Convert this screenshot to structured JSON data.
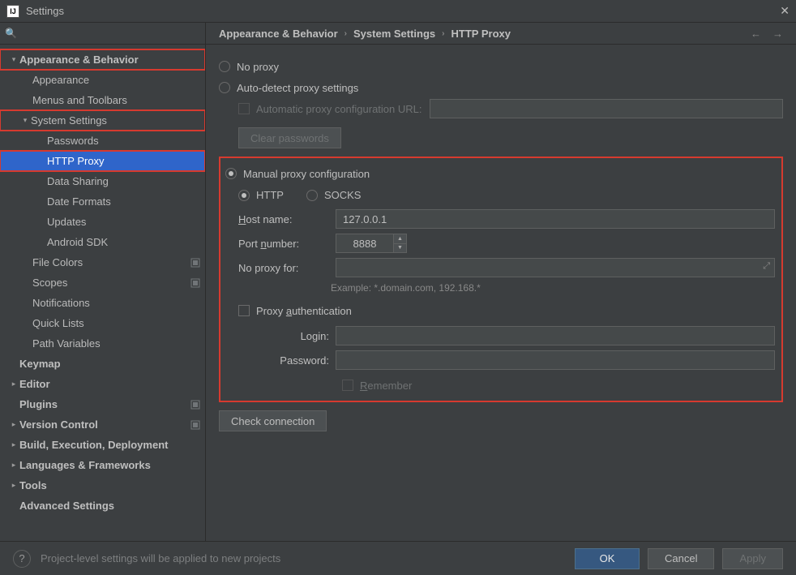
{
  "window": {
    "title": "Settings"
  },
  "search": {
    "placeholder": ""
  },
  "tree": {
    "appearanceBehavior": "Appearance & Behavior",
    "appearance": "Appearance",
    "menusToolbars": "Menus and Toolbars",
    "systemSettings": "System Settings",
    "passwords": "Passwords",
    "httpProxy": "HTTP Proxy",
    "dataSharing": "Data Sharing",
    "dateFormats": "Date Formats",
    "updates": "Updates",
    "androidSdk": "Android SDK",
    "fileColors": "File Colors",
    "scopes": "Scopes",
    "notifications": "Notifications",
    "quickLists": "Quick Lists",
    "pathVariables": "Path Variables",
    "keymap": "Keymap",
    "editor": "Editor",
    "plugins": "Plugins",
    "versionControl": "Version Control",
    "buildExec": "Build, Execution, Deployment",
    "langFrameworks": "Languages & Frameworks",
    "tools": "Tools",
    "advanced": "Advanced Settings"
  },
  "breadcrumb": {
    "a": "Appearance & Behavior",
    "b": "System Settings",
    "c": "HTTP Proxy"
  },
  "form": {
    "noProxy": "No proxy",
    "autoDetect": "Auto-detect proxy settings",
    "autoConfigUrl": "Automatic proxy configuration URL:",
    "clearPasswords": "Clear passwords",
    "manual": "Manual proxy configuration",
    "http": "HTTP",
    "socks": "SOCKS",
    "hostLabelPre": "H",
    "hostLabel": "ost name:",
    "hostValue": "127.0.0.1",
    "portLabelPre": "Port ",
    "portLabelU": "n",
    "portLabelPost": "umber:",
    "portValue": "8888",
    "noProxyFor": "No proxy for:",
    "example": "Example: *.domain.com, 192.168.*",
    "proxyAuthPre": "Proxy ",
    "proxyAuthU": "a",
    "proxyAuthPost": "uthentication",
    "login": "Login:",
    "password": "Password:",
    "rememberU": "R",
    "rememberPost": "emember",
    "checkConn": "Check connection"
  },
  "bottom": {
    "hint": "Project-level settings will be applied to new projects",
    "ok": "OK",
    "cancel": "Cancel",
    "apply": "Apply"
  }
}
